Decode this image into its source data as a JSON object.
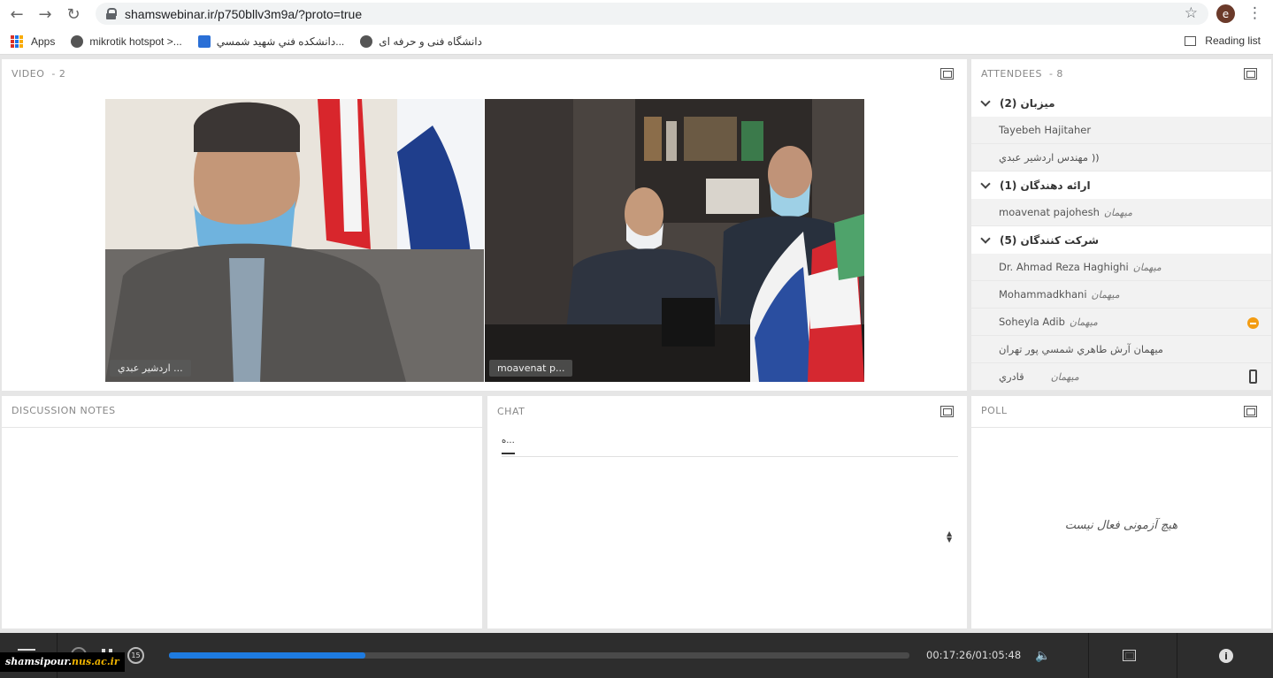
{
  "browser": {
    "url": "shamswebinar.ir/p750bllv3m9a/?proto=true",
    "profile_initial": "e",
    "bookmarks": [
      {
        "label": "Apps"
      },
      {
        "label": "mikrotik hotspot >..."
      },
      {
        "label": "دانشكده فني شهيد شمسي..."
      },
      {
        "label": "دانشگاه فنی و حرفه ای"
      }
    ],
    "reading_list": "Reading list"
  },
  "video_pod": {
    "title": "VIDEO",
    "count": "- 2",
    "tiles": [
      {
        "label": "اردشير عبدي ..."
      },
      {
        "label": "moavenat p..."
      }
    ]
  },
  "attendees_pod": {
    "title": "ATTENDEES",
    "count": "- 8",
    "groups": [
      {
        "label": "ميزبان (2)",
        "members": [
          {
            "name": "Tayebeh Hajitaher",
            "role": ""
          },
          {
            "name": "مهندس اردشير عبدي",
            "role": ""
          }
        ]
      },
      {
        "label": "ارائه دهندگان (1)",
        "members": [
          {
            "name": "moavenat pajohesh",
            "role": "میهمان"
          }
        ]
      },
      {
        "label": "شركت كنندگان (5)",
        "members": [
          {
            "name": "Dr. Ahmad Reza Haghighi",
            "role": "میهمان"
          },
          {
            "name": "Mohammadkhani",
            "role": "میهمان"
          },
          {
            "name": "Soheyla Adib",
            "role": "میهمان"
          },
          {
            "name": "میهمان آرش طاهري شمسي پور تهران",
            "role": ""
          },
          {
            "name": "قادري",
            "role": "میهمان"
          }
        ]
      }
    ]
  },
  "notes_pod": {
    "title": "DISCUSSION NOTES"
  },
  "chat_pod": {
    "title": "CHAT",
    "tab_label": "ه..."
  },
  "poll_pod": {
    "title": "POLL",
    "empty_message": "هيچ آزمونی فعال نيست"
  },
  "player": {
    "elapsed": "00:17:26",
    "total": "01:05:48",
    "progress": 0.265,
    "skip_seconds": "15"
  },
  "watermark": {
    "prefix": "shamsipour.",
    "domain": "nus.ac.ir"
  },
  "colors": {
    "progress": "#1e7be0",
    "status_away": "#f39c12"
  }
}
